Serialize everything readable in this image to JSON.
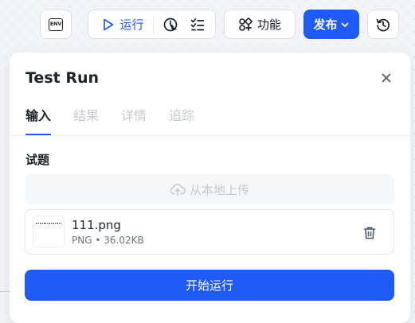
{
  "toolbar": {
    "env_label": "ENV",
    "run_label": "运行",
    "func_label": "功能",
    "publish_label": "发布"
  },
  "panel": {
    "title": "Test Run",
    "tabs": [
      {
        "label": "输入",
        "active": true
      },
      {
        "label": "结果",
        "active": false
      },
      {
        "label": "详情",
        "active": false
      },
      {
        "label": "追踪",
        "active": false
      }
    ],
    "section_label": "试题",
    "upload_label": "从本地上传",
    "file": {
      "name": "111.png",
      "type": "PNG",
      "separator": "•",
      "size": "36.02KB"
    },
    "start_label": "开始运行"
  },
  "colors": {
    "accent": "#1e5af5",
    "disabled_text": "#c6c9cf",
    "border": "#dee0e3"
  },
  "icons": [
    "env-icon",
    "play-icon",
    "timer-icon",
    "list-check-icon",
    "feature-icon",
    "chevron-down-icon",
    "history-icon",
    "close-icon",
    "cloud-upload-icon",
    "trash-icon"
  ]
}
